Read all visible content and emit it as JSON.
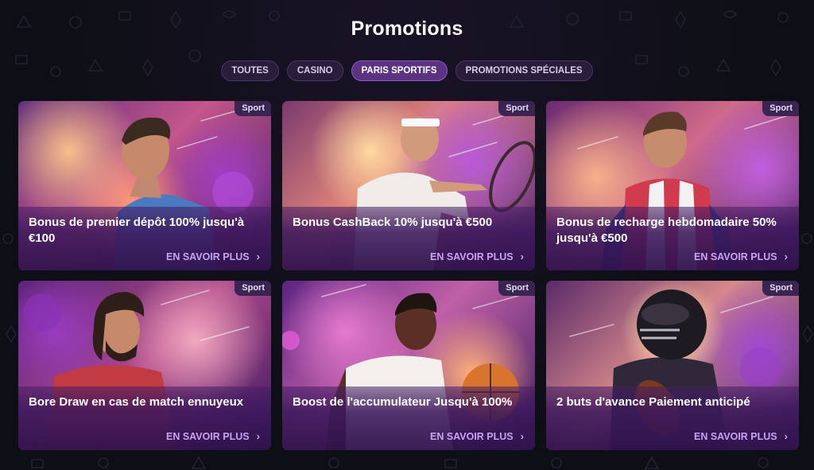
{
  "page": {
    "title": "Promotions"
  },
  "tabs": [
    {
      "label": "TOUTES",
      "active": false
    },
    {
      "label": "CASINO",
      "active": false
    },
    {
      "label": "PARIS SPORTIFS",
      "active": true
    },
    {
      "label": "PROMOTIONS SPÉCIALES",
      "active": false
    }
  ],
  "cards": [
    {
      "badge": "Sport",
      "title": "Bonus de premier dépôt 100% jusqu'à €100",
      "link": "EN SAVOIR PLUS",
      "image_icon": "football-player-icon"
    },
    {
      "badge": "Sport",
      "title": "Bonus CashBack 10% jusqu'à €500",
      "link": "EN SAVOIR PLUS",
      "image_icon": "tennis-player-icon"
    },
    {
      "badge": "Sport",
      "title": "Bonus de recharge hebdomadaire 50% jusqu'à €500",
      "link": "EN SAVOIR PLUS",
      "image_icon": "football-player-icon"
    },
    {
      "badge": "Sport",
      "title": "Bore Draw en cas de match ennuyeux",
      "link": "EN SAVOIR PLUS",
      "image_icon": "football-player-icon"
    },
    {
      "badge": "Sport",
      "title": "Boost de l'accumulateur Jusqu'à 100%",
      "link": "EN SAVOIR PLUS",
      "image_icon": "basketball-player-icon"
    },
    {
      "badge": "Sport",
      "title": "2 buts d'avance Paiement anticipé",
      "link": "EN SAVOIR PLUS",
      "image_icon": "american-football-player-icon"
    }
  ],
  "colors": {
    "background": "#0e0f16",
    "accent": "#5b3382",
    "link": "#c8a3f5",
    "badge_bg": "#3a2552"
  }
}
